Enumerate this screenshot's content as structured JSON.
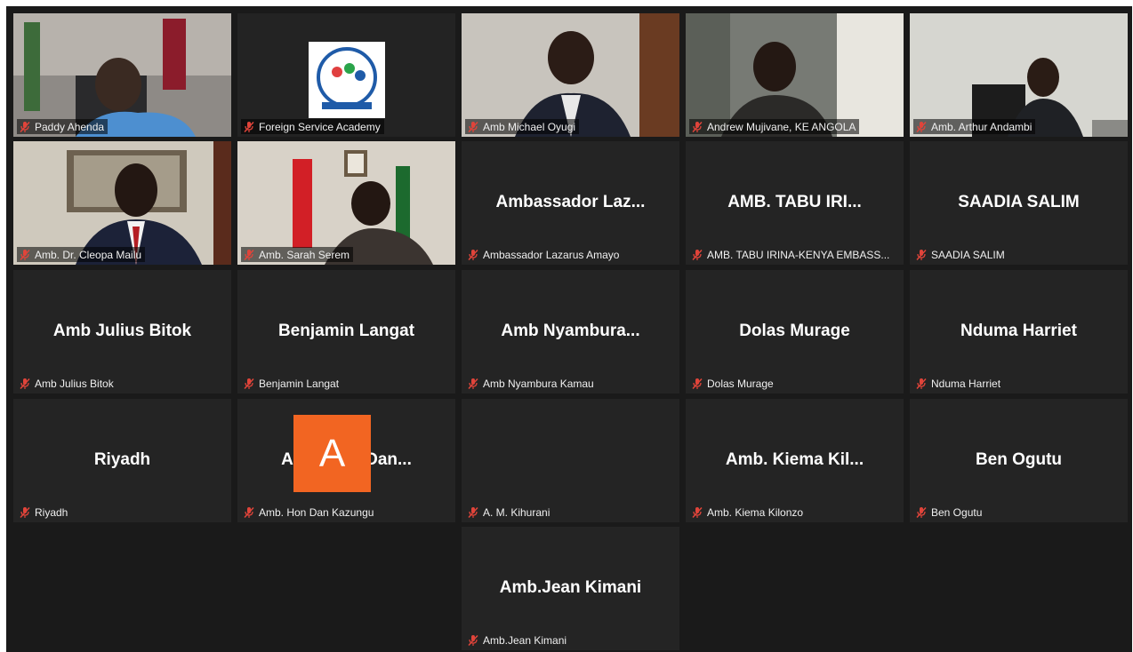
{
  "tiles": [
    {
      "label": "Paddy Ahenda",
      "video": true
    },
    {
      "label": "Foreign Service Academy",
      "video": true
    },
    {
      "label": "Amb Michael Oyugi",
      "video": true
    },
    {
      "label": "Andrew Mujivane, KE ANGOLA",
      "video": true
    },
    {
      "label": "Amb. Arthur Andambi",
      "video": true
    },
    {
      "label": "Amb. Dr. Cleopa Mailu",
      "video": true,
      "speaking": true
    },
    {
      "label": "Amb. Sarah Serem",
      "video": true
    },
    {
      "display_name": "Ambassador  Laz...",
      "label": "Ambassador Lazarus Amayo"
    },
    {
      "display_name": "AMB.  TABU  IRI...",
      "label": "AMB. TABU IRINA-KENYA EMBASS..."
    },
    {
      "display_name": "SAADIA SALIM",
      "label": "SAADIA SALIM"
    },
    {
      "display_name": "Amb Julius Bitok",
      "label": "Amb Julius Bitok"
    },
    {
      "display_name": "Benjamin Langat",
      "label": "Benjamin Langat"
    },
    {
      "display_name": "Amb  Nyambura...",
      "label": "Amb Nyambura Kamau"
    },
    {
      "display_name": "Dolas Murage",
      "label": "Dolas Murage"
    },
    {
      "display_name": "Nduma Harriet",
      "label": "Nduma Harriet"
    },
    {
      "display_name": "Riyadh",
      "label": "Riyadh"
    },
    {
      "display_name": "Amb.  Hon  Dan...",
      "label": "Amb. Hon Dan Kazungu"
    },
    {
      "avatar_letter": "A",
      "label": "A. M. Kihurani"
    },
    {
      "display_name": "Amb.  Kiema  Kil...",
      "label": "Amb. Kiema Kilonzo"
    },
    {
      "display_name": "Ben Ogutu",
      "label": "Ben Ogutu"
    },
    {
      "display_name": "Amb.Jean Kimani",
      "label": "Amb.Jean Kimani"
    }
  ],
  "colors": {
    "muted_mic": "#e0443a",
    "avatar_bg": "#f26522",
    "speaker_border": "#d8e06a"
  },
  "icons": {
    "mic": "muted-microphone-icon"
  }
}
